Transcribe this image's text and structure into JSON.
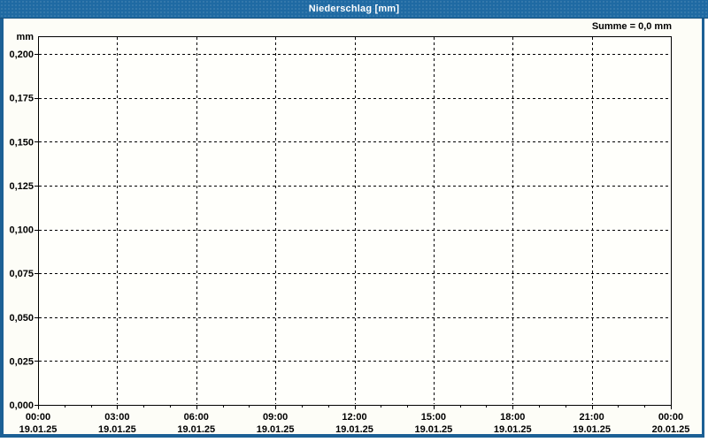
{
  "titlebar": {
    "title": "Niederschlag [mm]"
  },
  "annotations": {
    "sum_label": "Summe = 0,0 mm"
  },
  "colors": {
    "titlebar": "#1f6aa3",
    "titlebar_edge": "#17507c",
    "frame_border": "#1c6095",
    "content_bg": "#fdfdf7",
    "plot_bg": "#fffffb",
    "grid": "#000000",
    "title_text": "#ffffff",
    "label_text": "#000000"
  },
  "chart_data": {
    "type": "line",
    "title": "Niederschlag [mm]",
    "xlabel": "",
    "ylabel": "mm",
    "ylim": [
      0,
      0.21
    ],
    "grid": "dashed",
    "legend_position": "none",
    "sum_annotation": "Summe = 0,0 mm",
    "y_ticks": [
      {
        "value": 0.2,
        "label": "0,200"
      },
      {
        "value": 0.175,
        "label": "0,175"
      },
      {
        "value": 0.15,
        "label": "0,150"
      },
      {
        "value": 0.125,
        "label": "0,125"
      },
      {
        "value": 0.1,
        "label": "0,100"
      },
      {
        "value": 0.075,
        "label": "0,075"
      },
      {
        "value": 0.05,
        "label": "0,050"
      },
      {
        "value": 0.025,
        "label": "0,025"
      },
      {
        "value": 0.0,
        "label": "0,000"
      }
    ],
    "x_ticks": [
      {
        "time": "00:00",
        "date": "19.01.25"
      },
      {
        "time": "03:00",
        "date": "19.01.25"
      },
      {
        "time": "06:00",
        "date": "19.01.25"
      },
      {
        "time": "09:00",
        "date": "19.01.25"
      },
      {
        "time": "12:00",
        "date": "19.01.25"
      },
      {
        "time": "15:00",
        "date": "19.01.25"
      },
      {
        "time": "18:00",
        "date": "19.01.25"
      },
      {
        "time": "21:00",
        "date": "19.01.25"
      },
      {
        "time": "00:00",
        "date": "20.01.25"
      }
    ],
    "minor_x_ticks_per_interval": 2,
    "series": [
      {
        "name": "Niederschlag",
        "values": []
      }
    ]
  }
}
